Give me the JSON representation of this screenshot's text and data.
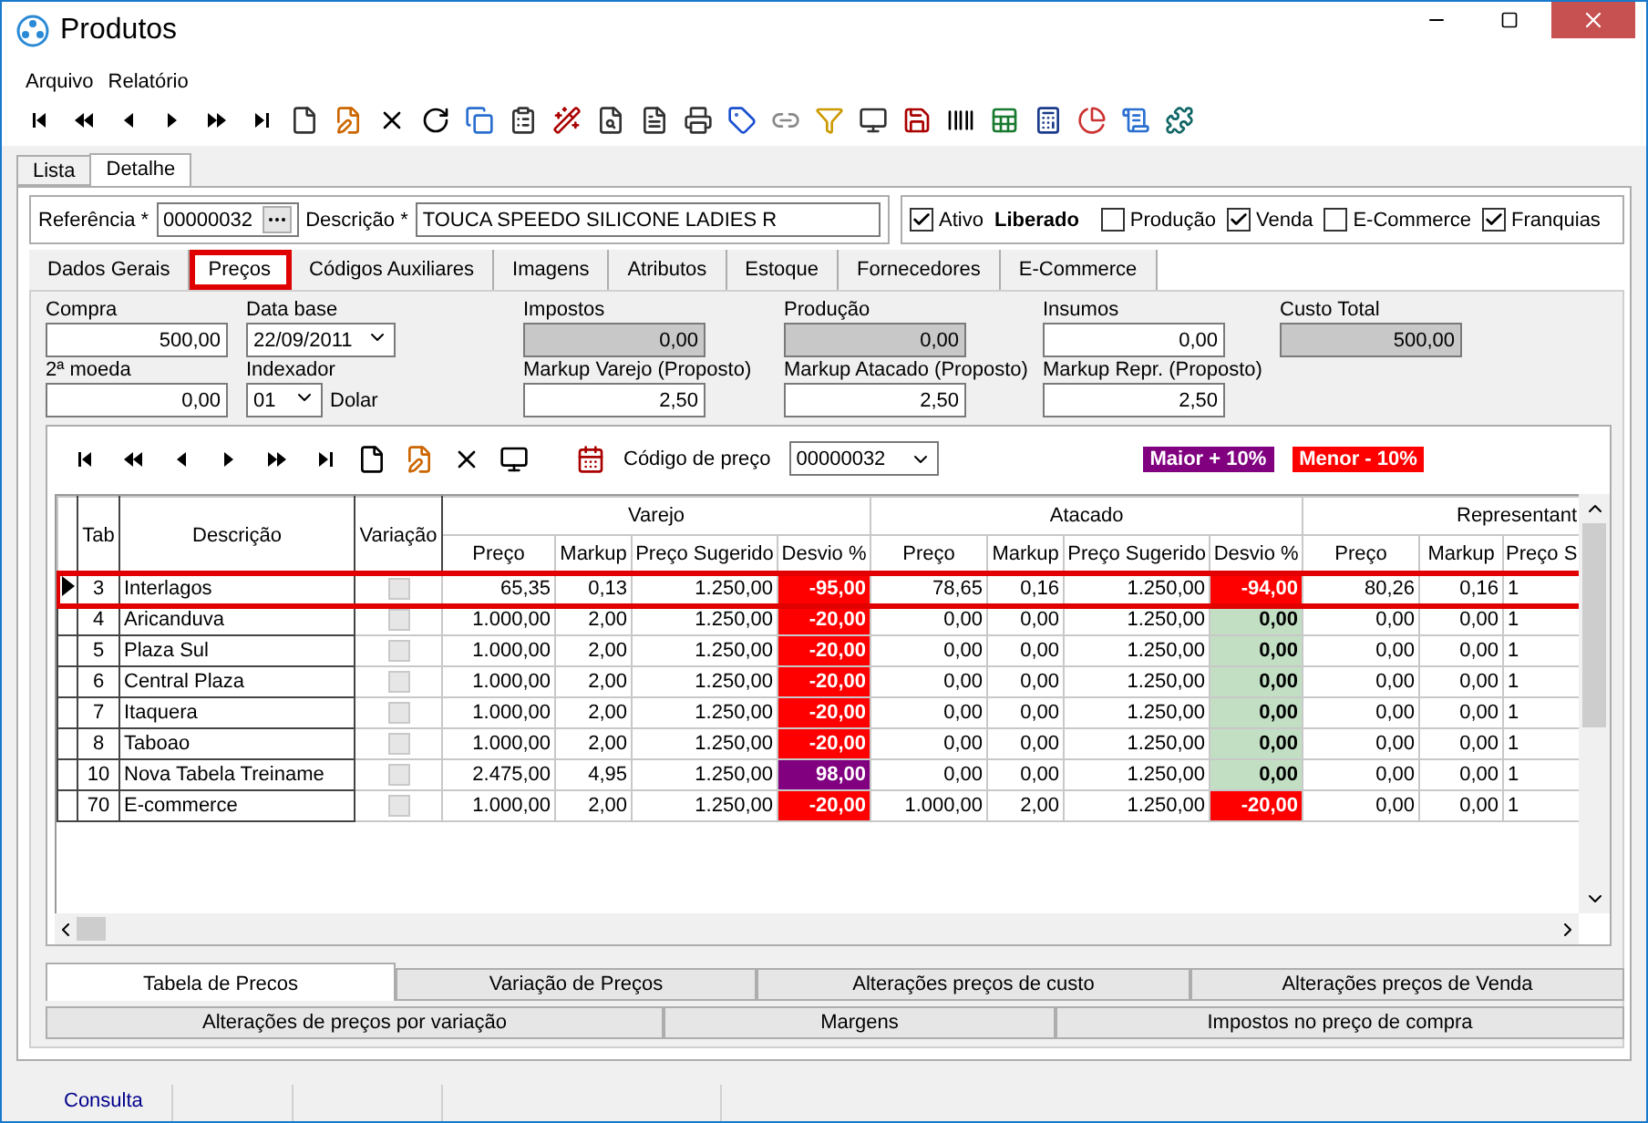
{
  "window": {
    "title": "Produtos"
  },
  "menu": [
    "Arquivo",
    "Relatório"
  ],
  "view_tabs": [
    {
      "label": "Lista",
      "selected": false
    },
    {
      "label": "Detalhe",
      "selected": true
    }
  ],
  "header": {
    "referencia_label": "Referência *",
    "referencia": "00000032",
    "descricao_label": "Descrição *",
    "descricao": "TOUCA SPEEDO SILICONE LADIES R",
    "flags": [
      {
        "label": "Ativo",
        "checked": true
      },
      {
        "label": "Produção",
        "checked": false
      },
      {
        "label": "Venda",
        "checked": true
      },
      {
        "label": "E-Commerce",
        "checked": false
      },
      {
        "label": "Franquias",
        "checked": true
      }
    ],
    "status": "Liberado"
  },
  "sections": [
    {
      "label": "Dados Gerais",
      "selected": false
    },
    {
      "label": "Preços",
      "selected": true
    },
    {
      "label": "Códigos Auxiliares",
      "selected": false
    },
    {
      "label": "Imagens",
      "selected": false
    },
    {
      "label": "Atributos",
      "selected": false
    },
    {
      "label": "Estoque",
      "selected": false
    },
    {
      "label": "Fornecedores",
      "selected": false
    },
    {
      "label": "E-Commerce",
      "selected": false
    }
  ],
  "fields_row1": [
    {
      "label": "Compra",
      "value": "500,00",
      "kind": "input"
    },
    {
      "label": "Data base",
      "value": "22/09/2011",
      "kind": "date"
    },
    {
      "label": "Impostos",
      "value": "0,00",
      "kind": "readonly"
    },
    {
      "label": "Produção",
      "value": "0,00",
      "kind": "readonly"
    },
    {
      "label": "Insumos",
      "value": "0,00",
      "kind": "input"
    },
    {
      "label": "Custo Total",
      "value": "500,00",
      "kind": "readonly"
    }
  ],
  "fields_row2": [
    {
      "label": "2ª moeda",
      "value": "0,00",
      "kind": "input"
    },
    {
      "label": "Indexador",
      "value": "01",
      "suffix": "Dolar",
      "kind": "select"
    },
    {
      "label": "Markup Varejo (Proposto)",
      "value": "2,50",
      "kind": "input"
    },
    {
      "label": "Markup Atacado (Proposto)",
      "value": "2,50",
      "kind": "input"
    },
    {
      "label": "Markup Repr. (Proposto)",
      "value": "2,50",
      "kind": "input"
    }
  ],
  "price_code": {
    "label": "Código de preço",
    "value": "00000032"
  },
  "legend": [
    {
      "label": "Maior + 10%",
      "kind": "high"
    },
    {
      "label": "Menor - 10%",
      "kind": "low"
    }
  ],
  "table": {
    "columns": [
      "Tab",
      "Descrição",
      "Variação"
    ],
    "groups": [
      {
        "title": "Varejo",
        "columns": [
          "Preço",
          "Markup",
          "Preço Sugerido",
          "Desvio %"
        ]
      },
      {
        "title": "Atacado",
        "columns": [
          "Preço",
          "Markup",
          "Preço Sugerido",
          "Desvio %"
        ]
      },
      {
        "title": "Representant",
        "columns": [
          "Preço",
          "Markup",
          "Preço S"
        ]
      }
    ],
    "rows": [
      {
        "selected": true,
        "tab": "3",
        "descricao": "Interlagos",
        "variacao": false,
        "varejo": [
          "65,35",
          "0,13",
          "1.250,00",
          {
            "value": "-95,00",
            "kind": "low"
          }
        ],
        "atacado": [
          "78,65",
          "0,16",
          "1.250,00",
          {
            "value": "-94,00",
            "kind": "low"
          }
        ],
        "representante": [
          "80,26",
          "0,16",
          "1"
        ]
      },
      {
        "selected": false,
        "tab": "4",
        "descricao": "Aricanduva",
        "variacao": false,
        "varejo": [
          "1.000,00",
          "2,00",
          "1.250,00",
          {
            "value": "-20,00",
            "kind": "low"
          }
        ],
        "atacado": [
          "0,00",
          "0,00",
          "1.250,00",
          {
            "value": "0,00",
            "kind": "ok"
          }
        ],
        "representante": [
          "0,00",
          "0,00",
          "1"
        ]
      },
      {
        "selected": false,
        "tab": "5",
        "descricao": "Plaza Sul",
        "variacao": false,
        "varejo": [
          "1.000,00",
          "2,00",
          "1.250,00",
          {
            "value": "-20,00",
            "kind": "low"
          }
        ],
        "atacado": [
          "0,00",
          "0,00",
          "1.250,00",
          {
            "value": "0,00",
            "kind": "ok"
          }
        ],
        "representante": [
          "0,00",
          "0,00",
          "1"
        ]
      },
      {
        "selected": false,
        "tab": "6",
        "descricao": "Central Plaza",
        "variacao": false,
        "varejo": [
          "1.000,00",
          "2,00",
          "1.250,00",
          {
            "value": "-20,00",
            "kind": "low"
          }
        ],
        "atacado": [
          "0,00",
          "0,00",
          "1.250,00",
          {
            "value": "0,00",
            "kind": "ok"
          }
        ],
        "representante": [
          "0,00",
          "0,00",
          "1"
        ]
      },
      {
        "selected": false,
        "tab": "7",
        "descricao": "Itaquera",
        "variacao": false,
        "varejo": [
          "1.000,00",
          "2,00",
          "1.250,00",
          {
            "value": "-20,00",
            "kind": "low"
          }
        ],
        "atacado": [
          "0,00",
          "0,00",
          "1.250,00",
          {
            "value": "0,00",
            "kind": "ok"
          }
        ],
        "representante": [
          "0,00",
          "0,00",
          "1"
        ]
      },
      {
        "selected": false,
        "tab": "8",
        "descricao": "Taboao",
        "variacao": false,
        "varejo": [
          "1.000,00",
          "2,00",
          "1.250,00",
          {
            "value": "-20,00",
            "kind": "low"
          }
        ],
        "atacado": [
          "0,00",
          "0,00",
          "1.250,00",
          {
            "value": "0,00",
            "kind": "ok"
          }
        ],
        "representante": [
          "0,00",
          "0,00",
          "1"
        ]
      },
      {
        "selected": false,
        "tab": "10",
        "descricao": "Nova Tabela Treiname",
        "variacao": false,
        "varejo": [
          "2.475,00",
          "4,95",
          "1.250,00",
          {
            "value": "98,00",
            "kind": "high"
          }
        ],
        "atacado": [
          "0,00",
          "0,00",
          "1.250,00",
          {
            "value": "0,00",
            "kind": "ok"
          }
        ],
        "representante": [
          "0,00",
          "0,00",
          "1"
        ]
      },
      {
        "selected": false,
        "tab": "70",
        "descricao": "E-commerce",
        "variacao": false,
        "varejo": [
          "1.000,00",
          "2,00",
          "1.250,00",
          {
            "value": "-20,00",
            "kind": "low"
          }
        ],
        "atacado": [
          "1.000,00",
          "2,00",
          "1.250,00",
          {
            "value": "-20,00",
            "kind": "low"
          }
        ],
        "representante": [
          "0,00",
          "0,00",
          "1"
        ]
      }
    ]
  },
  "bottom_tabs": [
    [
      {
        "label": "Tabela de Precos",
        "selected": true
      },
      {
        "label": "Variação de Preços",
        "selected": false
      },
      {
        "label": "Alterações preços de custo",
        "selected": false
      },
      {
        "label": "Alterações preços de Venda",
        "selected": false
      }
    ],
    [
      {
        "label": "Alterações de preços por variação",
        "selected": false
      },
      {
        "label": "Margens",
        "selected": false
      },
      {
        "label": "Impostos no preço de compra",
        "selected": false
      }
    ]
  ],
  "status_bar": [
    "Consulta"
  ]
}
